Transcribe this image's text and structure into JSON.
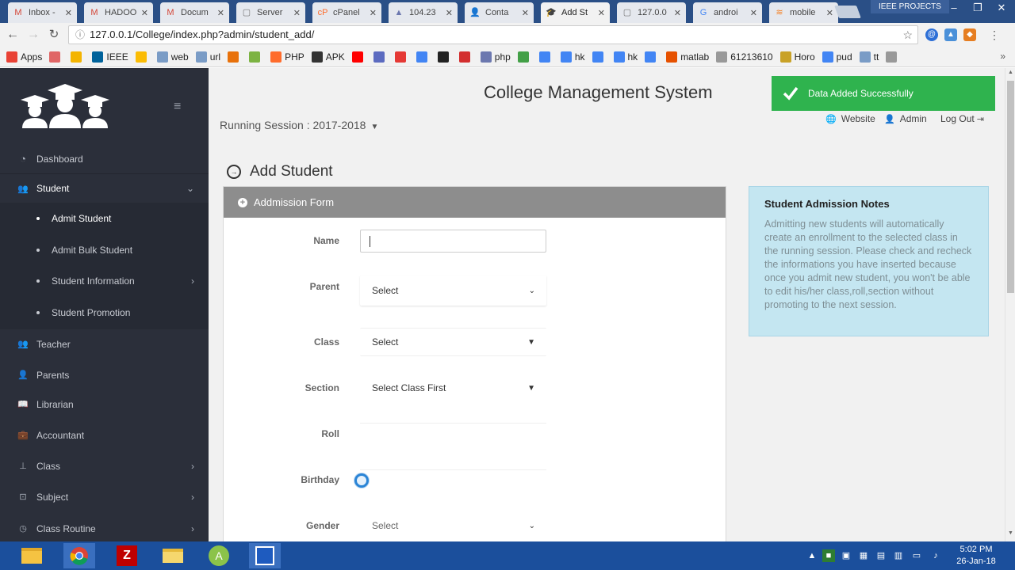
{
  "browser": {
    "tabs": [
      {
        "label": "Inbox -",
        "icon": "gmail-icon",
        "color": "#d44638"
      },
      {
        "label": "HADOO",
        "icon": "gmail-icon",
        "color": "#d44638"
      },
      {
        "label": "Docum",
        "icon": "gmail-icon",
        "color": "#d44638"
      },
      {
        "label": "Server",
        "icon": "page-icon",
        "color": "#777777"
      },
      {
        "label": "cPanel",
        "icon": "cpanel-icon",
        "color": "#ff6c2c"
      },
      {
        "label": "104.23",
        "icon": "phpmyadmin-icon",
        "color": "#6c78af"
      },
      {
        "label": "Conta",
        "icon": "user-icon",
        "color": "#555555"
      },
      {
        "label": "Add St",
        "icon": "graduation-icon",
        "color": "#333333"
      },
      {
        "label": "127.0.0",
        "icon": "page-icon",
        "color": "#777777"
      },
      {
        "label": "androi",
        "icon": "google-icon",
        "color": "#4285f4"
      },
      {
        "label": "mobile",
        "icon": "stackoverflow-icon",
        "color": "#f48024"
      }
    ],
    "profile_chip": "IEEE PROJECTS",
    "url": "127.0.0.1/College/index.php?admin/student_add/",
    "bookmarks": [
      {
        "label": "Apps",
        "color": "#e94235"
      },
      {
        "label": "",
        "color": "#e06666"
      },
      {
        "label": "",
        "color": "#f4b400"
      },
      {
        "label": "IEEE",
        "color": "#00629b"
      },
      {
        "label": "",
        "color": "#fbbc04"
      },
      {
        "label": "web",
        "color": "#7a9cc6"
      },
      {
        "label": "url",
        "color": "#7a9cc6"
      },
      {
        "label": "",
        "color": "#e8710a"
      },
      {
        "label": "",
        "color": "#7cb342"
      },
      {
        "label": "PHP",
        "color": "#ff6c2c"
      },
      {
        "label": "APK",
        "color": "#333333"
      },
      {
        "label": "",
        "color": "#ff0000"
      },
      {
        "label": "",
        "color": "#5c6bc0"
      },
      {
        "label": "",
        "color": "#e53935"
      },
      {
        "label": "",
        "color": "#4285f4"
      },
      {
        "label": "",
        "color": "#222222"
      },
      {
        "label": "",
        "color": "#d32f2f"
      },
      {
        "label": "php",
        "color": "#6c78af"
      },
      {
        "label": "",
        "color": "#43a047"
      },
      {
        "label": "",
        "color": "#4285f4"
      },
      {
        "label": "hk",
        "color": "#4285f4"
      },
      {
        "label": "",
        "color": "#4285f4"
      },
      {
        "label": "hk",
        "color": "#4285f4"
      },
      {
        "label": "",
        "color": "#4285f4"
      },
      {
        "label": "matlab",
        "color": "#e65100"
      },
      {
        "label": "61213610",
        "color": "#999999"
      },
      {
        "label": "Horo",
        "color": "#c9a227"
      },
      {
        "label": "pud",
        "color": "#4285f4"
      },
      {
        "label": "tt",
        "color": "#7a9cc6"
      },
      {
        "label": "",
        "color": "#999999"
      }
    ]
  },
  "sidebar": {
    "top_items": [
      {
        "label": "Dashboard",
        "icon": "dashboard-icon",
        "glyph": "◔"
      },
      {
        "label": "Student",
        "icon": "users-icon",
        "glyph": "👥"
      }
    ],
    "student_subitems": [
      {
        "label": "Admit Student"
      },
      {
        "label": "Admit Bulk Student"
      },
      {
        "label": "Student Information"
      },
      {
        "label": "Student Promotion"
      }
    ],
    "items": [
      {
        "label": "Teacher",
        "icon": "teacher-icon",
        "glyph": "👥"
      },
      {
        "label": "Parents",
        "icon": "parents-icon",
        "glyph": "👤"
      },
      {
        "label": "Librarian",
        "icon": "book-icon",
        "glyph": "📖"
      },
      {
        "label": "Accountant",
        "icon": "briefcase-icon",
        "glyph": "💼"
      },
      {
        "label": "Class",
        "icon": "sitemap-icon",
        "glyph": "⊥"
      },
      {
        "label": "Subject",
        "icon": "subject-icon",
        "glyph": "⊡"
      },
      {
        "label": "Class Routine",
        "icon": "routine-icon",
        "glyph": "◷"
      }
    ]
  },
  "header": {
    "app_title": "College Management System",
    "session_label": "Running Session : 2017-2018",
    "toast": "Data Added Successfully",
    "links": [
      {
        "label": "Website",
        "icon": "globe-icon"
      },
      {
        "label": "Admin",
        "icon": "user-icon"
      },
      {
        "label": "Log Out",
        "icon": "logout-icon"
      }
    ]
  },
  "page": {
    "heading": "Add Student",
    "form_title": "Addmission Form",
    "fields": {
      "name_label": "Name",
      "name_value": "",
      "parent_label": "Parent",
      "parent_value": "Select",
      "class_label": "Class",
      "class_value": "Select",
      "section_label": "Section",
      "section_value": "Select Class First",
      "roll_label": "Roll",
      "birthday_label": "Birthday",
      "gender_label": "Gender",
      "gender_value": "Select"
    },
    "notes": {
      "title": "Student Admission Notes",
      "body": "Admitting new students will automatically create an enrollment to the selected class in the running session. Please check and recheck the informations you have inserted because once you admit new student, you won't be able to edit his/her class,roll,section without promoting to the next session."
    }
  },
  "taskbar": {
    "apps": [
      "file-explorer",
      "chrome",
      "filezilla",
      "folder",
      "android-studio",
      "program-window"
    ],
    "time": "5:02 PM",
    "date": "26-Jan-18"
  },
  "colors": {
    "sidebar": "#2b2f3a",
    "toast": "#2fb34e",
    "panel_head": "#8d8d8d",
    "notes": "#c4e6f1",
    "taskbar": "#1b4f9c"
  }
}
